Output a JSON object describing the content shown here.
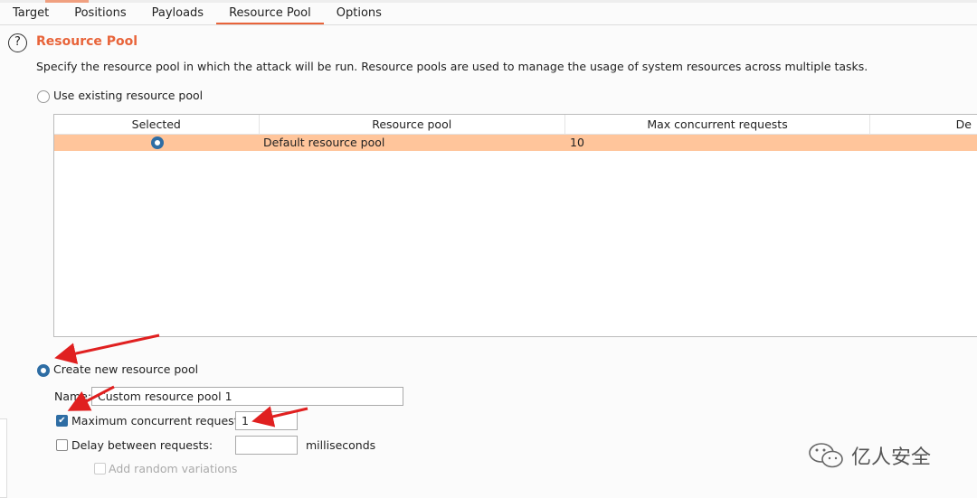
{
  "tabs": [
    {
      "label": "Target"
    },
    {
      "label": "Positions"
    },
    {
      "label": "Payloads"
    },
    {
      "label": "Resource Pool",
      "active": true
    },
    {
      "label": "Options"
    }
  ],
  "section": {
    "title": "Resource Pool",
    "description": "Specify the resource pool in which the attack will be run. Resource pools are used to manage the usage of system resources across multiple tasks."
  },
  "existing": {
    "label": "Use existing resource pool",
    "selected": false,
    "columns": [
      "Selected",
      "Resource pool",
      "Max concurrent requests",
      "De"
    ],
    "rows": [
      {
        "selected": true,
        "pool": "Default resource pool",
        "max": "10"
      }
    ]
  },
  "create": {
    "label": "Create new resource pool",
    "selected": true,
    "name_label": "Name:",
    "name_value": "Custom resource pool 1",
    "max_label": "Maximum concurrent requests:",
    "max_checked": true,
    "max_value": "1",
    "delay_label": "Delay between requests:",
    "delay_checked": false,
    "delay_value": "",
    "delay_unit": "milliseconds",
    "random_label": "Add random variations",
    "random_checked": false
  },
  "watermark": "亿人安全",
  "colors": {
    "accent": "#e8643a",
    "selected_row": "#ffc59b",
    "control": "#2e6da4",
    "annotation_arrow": "#e02020"
  }
}
